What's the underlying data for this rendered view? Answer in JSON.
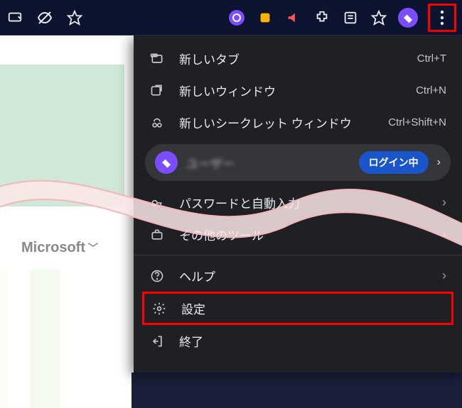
{
  "content": {
    "microsoft_label": "Microsoft"
  },
  "menu": {
    "new_tab": {
      "label": "新しいタブ",
      "shortcut": "Ctrl+T"
    },
    "new_window": {
      "label": "新しいウィンドウ",
      "shortcut": "Ctrl+N"
    },
    "new_incognito": {
      "label": "新しいシークレット ウィンドウ",
      "shortcut": "Ctrl+Shift+N"
    },
    "profile": {
      "name": "ユーザー",
      "login_status": "ログイン中"
    },
    "passwords": {
      "label": "パスワードと自動入力"
    },
    "more_tools": {
      "label": "その他のツール"
    },
    "help": {
      "label": "ヘルプ"
    },
    "settings": {
      "label": "設定"
    },
    "exit": {
      "label": "終了"
    }
  }
}
